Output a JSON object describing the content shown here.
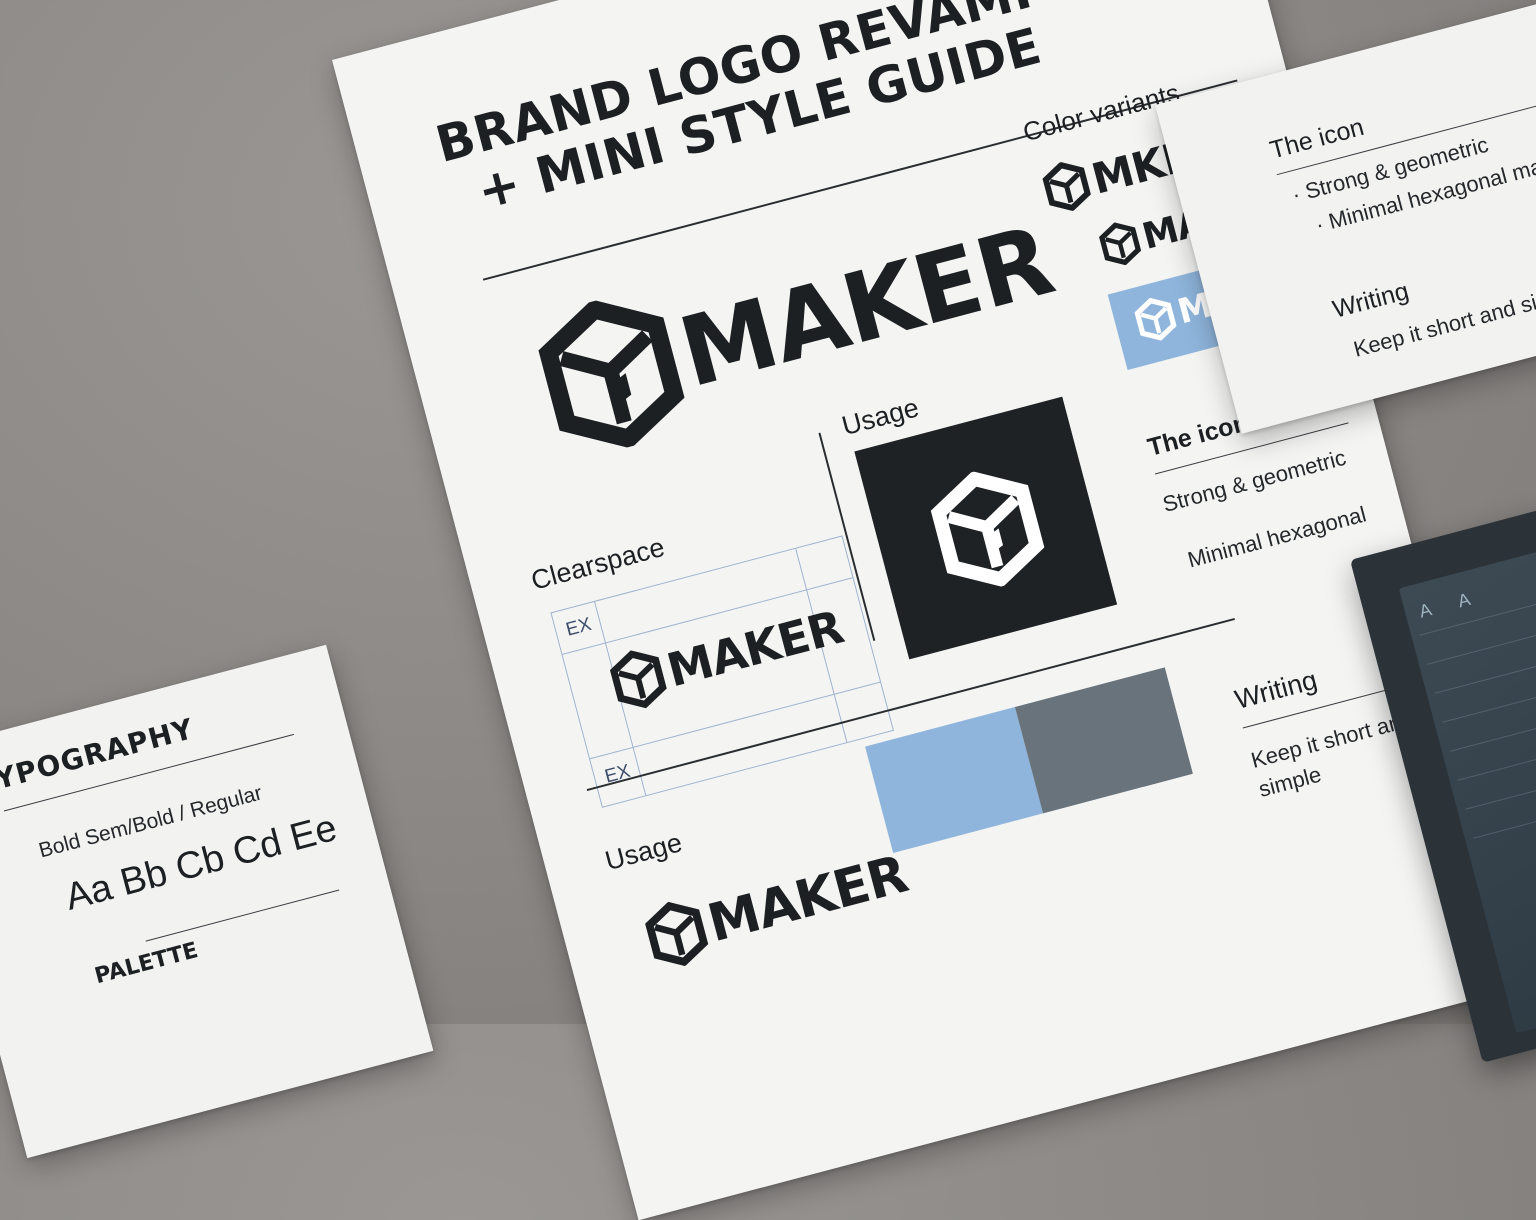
{
  "main": {
    "title_line1": "BRAND LOGO REVAMP",
    "title_line2": "+ MINI STYLE GUIDE",
    "wordmark": "MAKER",
    "color_variants_heading": "Color variants",
    "variant_1": "MKER",
    "variant_2": "MAKER",
    "variant_3": "MAKER",
    "clearspace_heading": "Clearspace",
    "clearspace_ex_top": "EX",
    "clearspace_ex_bottom": "EX",
    "clearspace_wordmark": "MAKER",
    "usage_heading": "Usage",
    "icon_heading": "The icon",
    "icon_point_1": "Strong & geometric",
    "icon_point_2": "Minimal hexagonal",
    "usage_heading_2": "Usage",
    "usage_wordmark": "MAKER",
    "writing_heading": "Writing",
    "writing_line_1": "Keep it short and",
    "writing_line_2": "simple"
  },
  "right_card": {
    "icon_heading": "The icon",
    "point_1": "Strong & geometric",
    "point_2": "Minimal hexagonal mark",
    "writing_heading": "Writing",
    "writing_text": "Keep it short and simple"
  },
  "left_card": {
    "heading": "YPOGRAPHY",
    "weights": "Bold  Sem/Bold / Regular",
    "specimen": "Aa Bb Cb Cd Ee",
    "palette_heading": "PALETTE"
  },
  "tablet": {
    "glyph_1": "A",
    "glyph_2": "A"
  },
  "colors": {
    "ink": "#1d2023",
    "paper": "#f4f4f3",
    "brand_blue": "#8fb5dc",
    "slate_gray": "#68737c",
    "background": "#8a8784"
  },
  "icons": [
    "hexagon-box-logo-icon"
  ]
}
